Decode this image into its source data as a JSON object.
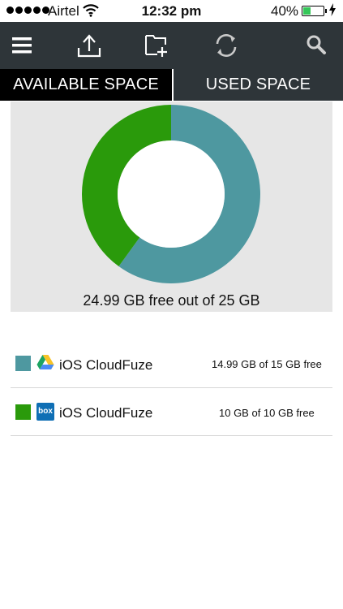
{
  "status_bar": {
    "carrier": "Airtel",
    "time": "12:32 pm",
    "battery_percent": "40%",
    "battery_level": 0.4
  },
  "toolbar": {
    "icons": [
      "menu-icon",
      "upload-icon",
      "new-folder-icon",
      "sync-icon",
      "search-icon"
    ]
  },
  "tabs": {
    "available": "AVAILABLE SPACE",
    "used": "USED SPACE"
  },
  "chart": {
    "caption": "24.99 GB free out of 25 GB"
  },
  "chart_data": {
    "type": "pie",
    "donut": true,
    "categories": [
      "Google Drive",
      "Box"
    ],
    "values": [
      14.99,
      10
    ],
    "colors": [
      "#4e98a0",
      "#2a9a0b"
    ],
    "title": "24.99 GB free out of 25 GB"
  },
  "storage": [
    {
      "swatch_color": "#4e98a0",
      "provider_icon": "google-drive-icon",
      "name": "iOS CloudFuze",
      "space": "14.99 GB of 15 GB free"
    },
    {
      "swatch_color": "#2a9a0b",
      "provider_icon": "box-icon",
      "provider_icon_text": "box",
      "name": "iOS CloudFuze",
      "space": "10 GB of 10 GB free"
    }
  ]
}
